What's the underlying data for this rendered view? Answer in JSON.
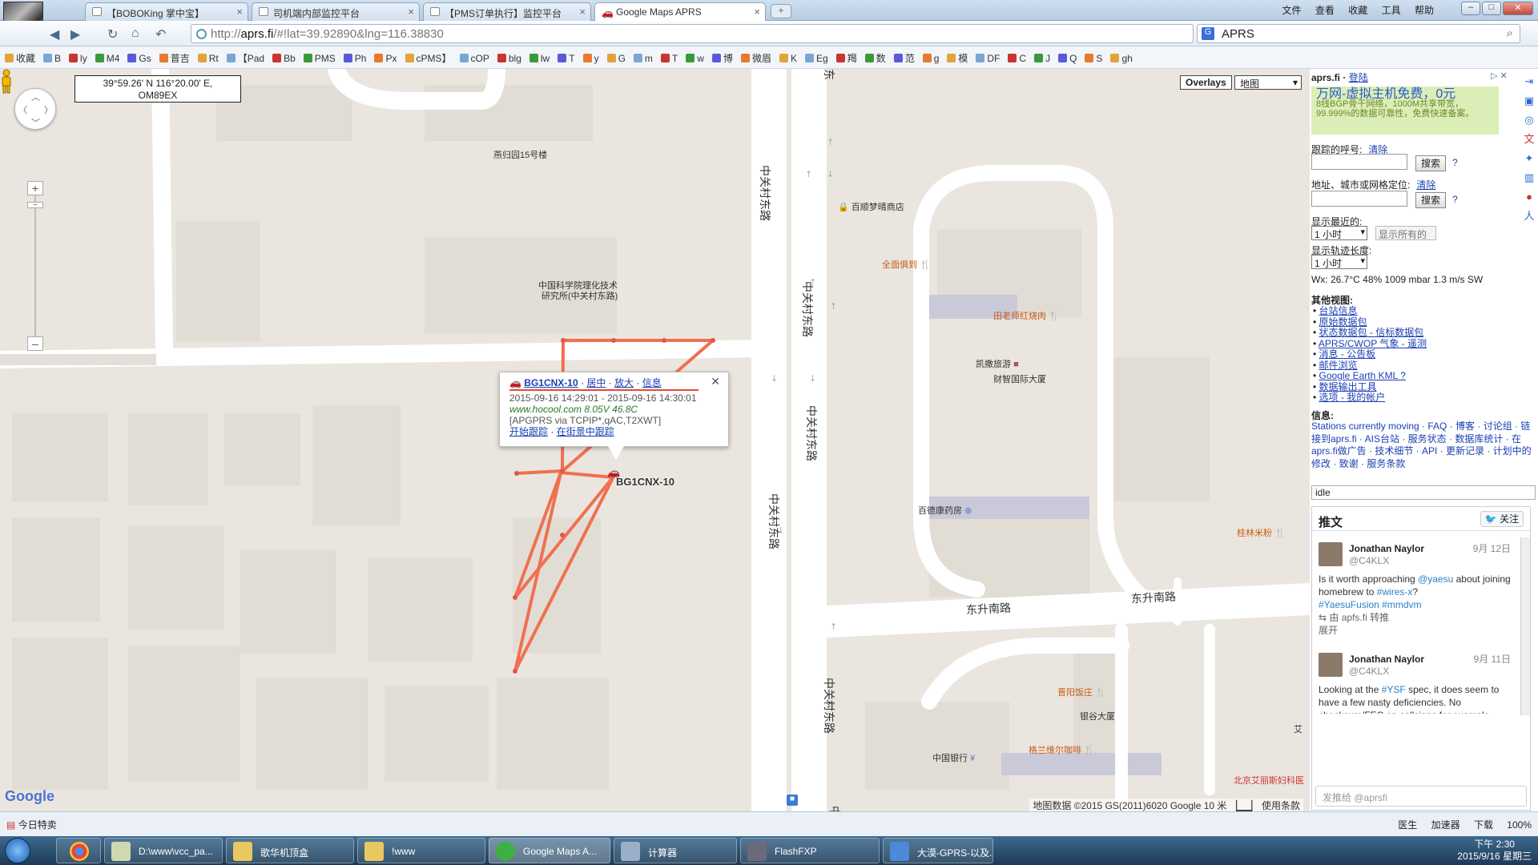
{
  "browser": {
    "tabs": [
      {
        "label": "【BOBOKing 掌中宝】"
      },
      {
        "label": "司机端内部监控平台"
      },
      {
        "label": "【PMS订单执行】监控平台"
      },
      {
        "label": "Google Maps APRS"
      }
    ],
    "menu": [
      "文件",
      "查看",
      "收藏",
      "工具",
      "帮助"
    ],
    "address_prefix": "http://",
    "address_host": "aprs.fi",
    "address_rest": "/#!lat=39.92890&lng=116.38830",
    "search_value": "APRS",
    "bookmarks": [
      "收藏",
      "B",
      "ly",
      "M4",
      "Gs",
      "普吉",
      "Rt",
      "【Pad",
      "Bb",
      "PMS",
      "Ph",
      "Px",
      "cPMS】",
      "cOP",
      "blg",
      "lw",
      "T",
      "y",
      "G",
      "m",
      "T",
      "w",
      "博",
      "微眉",
      "K",
      "Eg",
      "羯",
      "数",
      "范",
      "g",
      "模",
      "DF",
      "C",
      "J",
      "Q",
      "S",
      "gh"
    ]
  },
  "map": {
    "coord_line1": "39°59.26' N 116°20.00' E,",
    "coord_line2": "OM89EX",
    "overlays_label": "Overlays",
    "maptype_label": "地图",
    "labels": {
      "l1": "燕归园15号楼",
      "l2": "中国科学院理化技术",
      "l3": "研究所(中关村东路)",
      "l4": "百顺梦晴商店",
      "l5": "全面俱到",
      "l6": "田老师红烧肉",
      "l7": "凯撒旅游",
      "l8": "财智国际大厦",
      "l9": "百德康药房",
      "l10": "桂林米粉",
      "l11": "东升南路",
      "l12": "东升南路",
      "l13": "晋阳饭庄",
      "l14": "银谷大厦",
      "l15": "格兰维尔咖啡",
      "l16": "中国银行",
      "l17": "北京艾丽斯妇科医",
      "l18": "东",
      "l19": "艾",
      "road": "中关村东路"
    },
    "station_label": "BG1CNX-10",
    "popup": {
      "callsign": "BG1CNX-10",
      "link_center": "居中",
      "link_zoom": "放大",
      "link_info": "信息",
      "time_range": "2015-09-16 14:29:01 - 2015-09-16 14:30:01",
      "comment": "www.hocool.com 8.05V 46.8C",
      "path": "[APGPRS via TCPIP*,qAC,T2XWT]",
      "track_link": "开始跟踪",
      "streetview_link": "在街景中跟踪"
    },
    "google_logo": "Google",
    "attribution": "地图数据 ©2015 GS(2011)6020 Google   10 米 ▕▁▁▏  使用条款"
  },
  "sidebar": {
    "site": "aprs.fi",
    "login": "登陆",
    "ad_title": "万网-虚拟主机免费，0元",
    "ad_line1": "8线BGP骨干网络，1000M共享带宽，",
    "ad_line2": "99.999%的数据可靠性，免费快速备案。",
    "track_label": "跟踪的呼号:",
    "track_clear": "清除",
    "addr_label": "地址、城市或网格定位:",
    "addr_clear": "清除",
    "search_btn": "搜索",
    "q": "?",
    "recent_label": "显示最近的:",
    "recent_value": "1 小时",
    "show_all": "显示所有的",
    "tracklen_label": "显示轨迹长度:",
    "tracklen_value": "1 小时",
    "wx": "Wx: 26.7°C 48% 1009 mbar 1.3 m/s SW",
    "other_views": "其他视图:",
    "views": [
      "台站信息",
      "原始数据包",
      "状态数据包 - 信标数据包",
      "APRS/CWOP 气象 - 遥测",
      "消息 - 公告板",
      "邮件浏览",
      "Google Earth KML ?",
      "数据输出工具",
      "选项 - 我的帐户"
    ],
    "info_label": "信息:",
    "info_text": "Stations currently moving · FAQ · 博客 · 讨论组 · 链接到aprs.fi · AIS台站 · 服务状态 · 数据库统计 · 在aprs.fi做广告 · 技术细节 · API · 更新记录 · 计划中的修改 · 致谢 · 服务条款",
    "idle": "idle",
    "tweets_title": "推文",
    "follow": "关注",
    "tweets": [
      {
        "name": "Jonathan Naylor",
        "handle": "@C4KLX",
        "date": "9月 12日",
        "t1": "Is it worth approaching ",
        "h1": "@yaesu",
        "t2": " about joining homebrew to ",
        "h2": "#wires-x",
        "t3": "? ",
        "h3": "#YaesuFusion #mmdvm",
        "rt": "⇆ 由 apfs.fi 转推",
        "expand": "展开"
      },
      {
        "name": "Jonathan Naylor",
        "handle": "@C4KLX",
        "date": "9月 11日",
        "t1": "Looking at the ",
        "h1": "#YSF",
        "t2": " spec, it does seem to have a few nasty deficiencies. No checksum/FEC on callsigns for example."
      }
    ],
    "reply_placeholder": "发推给 @aprsfi"
  },
  "statusbar": {
    "left": "今日特卖",
    "items": [
      "医生",
      "加速器",
      "下载",
      "100%"
    ]
  },
  "taskbar": {
    "items": [
      "D:\\www\\vcc_pa...",
      "歌华机顶盒",
      "!www",
      "Google Maps A...",
      "计算器",
      "FlashFXP",
      "大漠-GPRS-以及..."
    ],
    "time": "下午 2:30",
    "date": "2015/9/16 星期三"
  },
  "colors": {
    "track": "#f07050",
    "accent": "#1a3fb3"
  }
}
